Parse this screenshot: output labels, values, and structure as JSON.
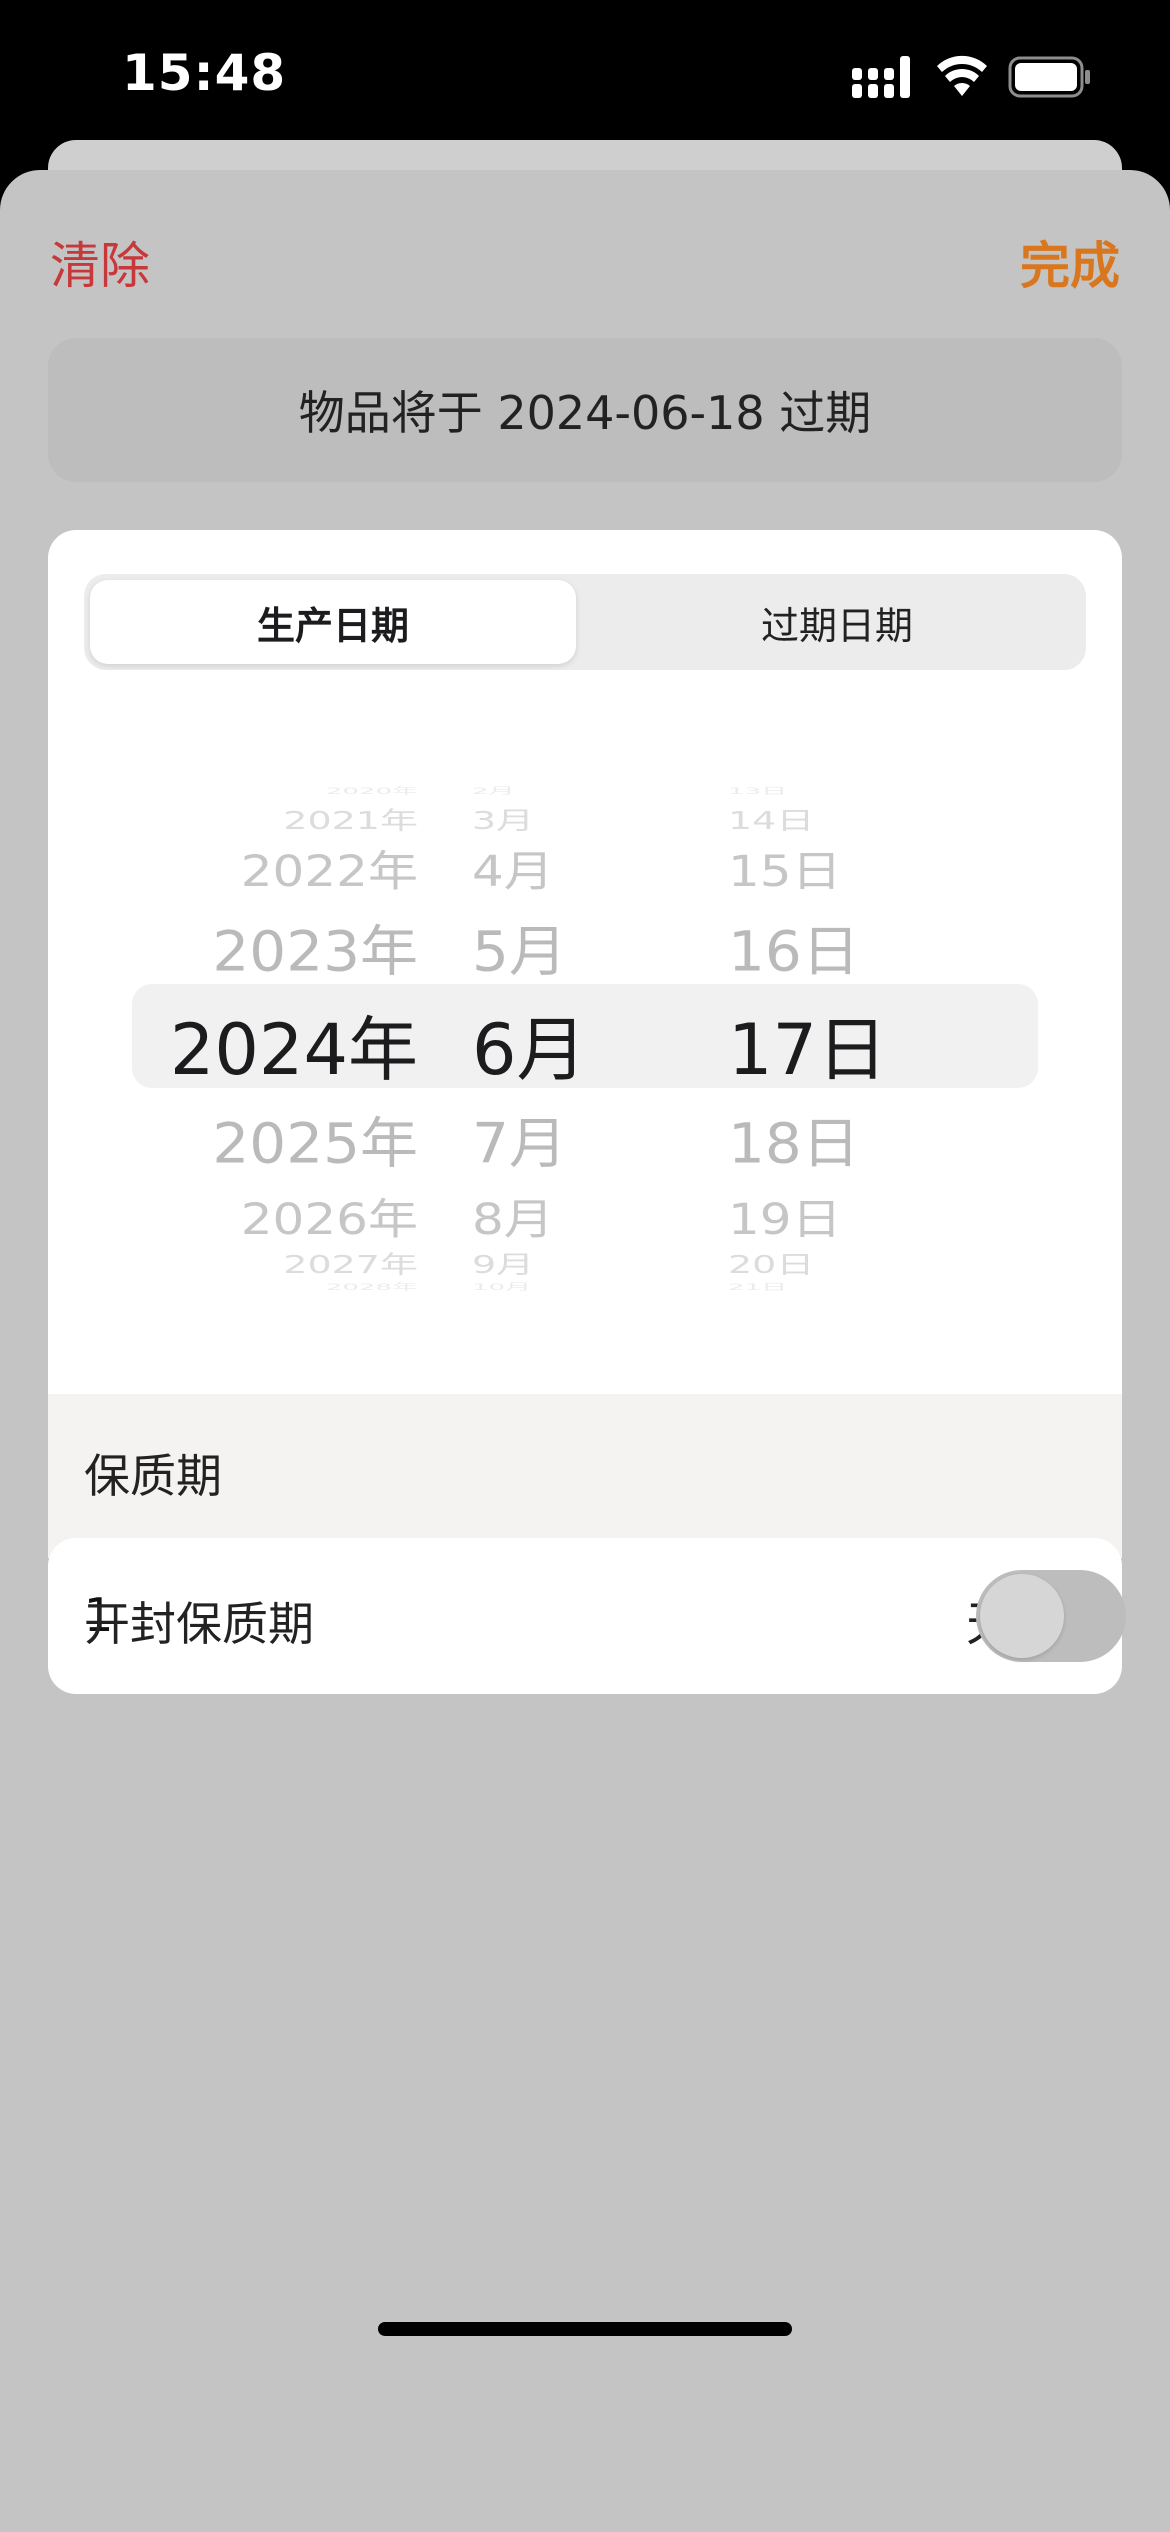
{
  "status_bar": {
    "time": "15:48"
  },
  "sheet": {
    "clear_label": "清除",
    "done_label": "完成",
    "info_text": "物品将于 2024-06-18 过期",
    "tabs": [
      {
        "label": "生产日期",
        "selected": true
      },
      {
        "label": "过期日期",
        "selected": false
      }
    ],
    "picker": {
      "years": [
        "2020年",
        "2021年",
        "2022年",
        "2023年",
        "2024年",
        "2025年",
        "2026年",
        "2027年",
        "2028年"
      ],
      "months": [
        "2月",
        "3月",
        "4月",
        "5月",
        "6月",
        "7月",
        "8月",
        "9月",
        "10月"
      ],
      "days": [
        "13日",
        "14日",
        "15日",
        "16日",
        "17日",
        "18日",
        "19日",
        "20日",
        "21日"
      ],
      "selected": {
        "year": "2024年",
        "month": "6月",
        "day": "17日"
      }
    },
    "shelf_life": {
      "title": "保质期",
      "value": "1",
      "unit": "天"
    },
    "opened_shelf_life": {
      "label": "开封保质期",
      "enabled": false
    }
  },
  "colors": {
    "accent": "#d9771f",
    "destructive": "#c7383a"
  }
}
